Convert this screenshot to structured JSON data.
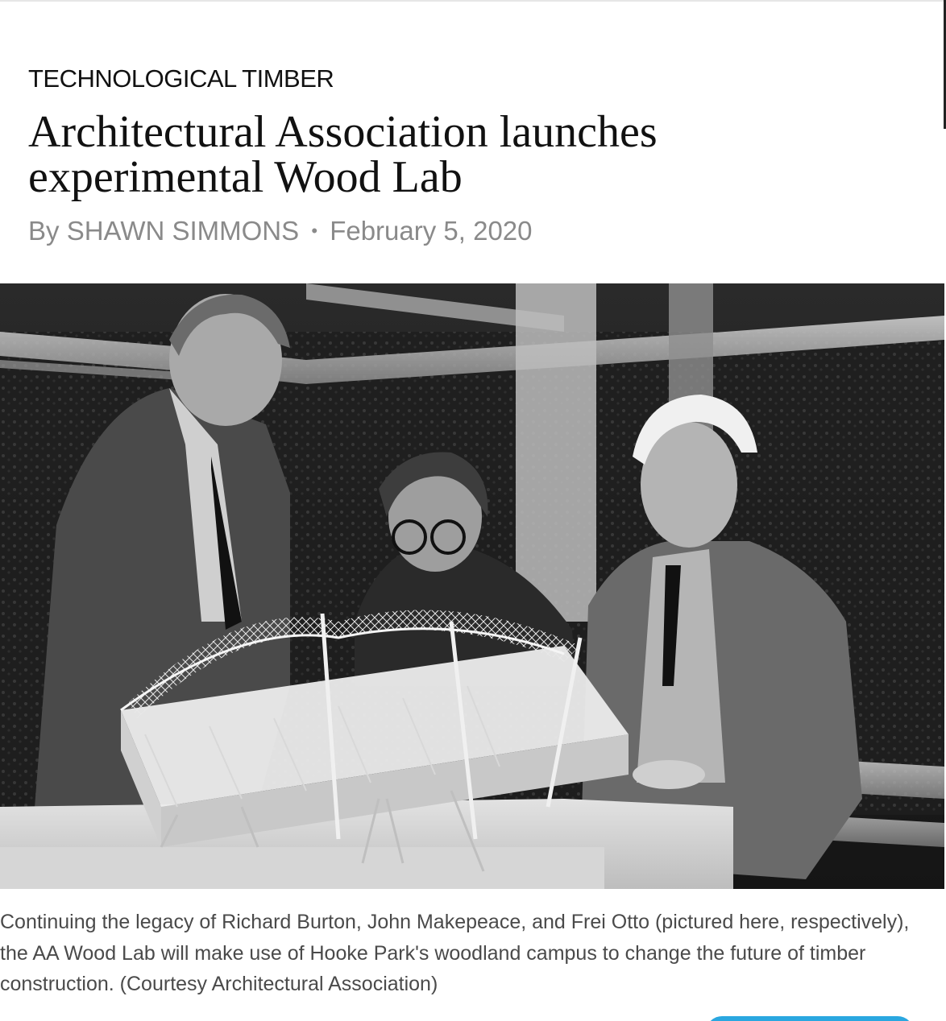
{
  "article": {
    "kicker": "TECHNOLOGICAL TIMBER",
    "headline": "Architectural Association launches experimental Wood Lab",
    "byline": {
      "prefix": "By",
      "author": "SHAWN SIMMONS",
      "separator": "•",
      "date": "February 5, 2020"
    },
    "image": {
      "description_icon": "photo"
    },
    "caption": "Continuing the legacy of Richard Burton, John Makepeace, and Frei Otto (pictured here, respectively), the AA Wood Lab will make use of Hooke Park's woodland campus to change the future of timber construction. (Courtesy Architectural Association)"
  },
  "colors": {
    "text": "#111111",
    "byline": "#8a8a8a",
    "caption": "#4a4a4a",
    "accent": "#2aa7e0"
  }
}
